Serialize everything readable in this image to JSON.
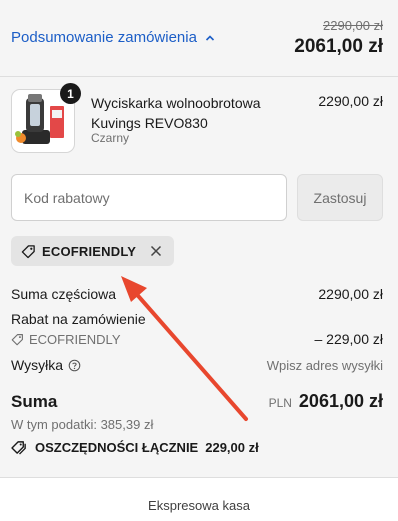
{
  "summary": {
    "toggle_label": "Podsumowanie zamówienia",
    "old_total": "2290,00 zł",
    "new_total": "2061,00 zł"
  },
  "product": {
    "quantity": "1",
    "name": "Wyciskarka wolnoobrotowa Kuvings REVO830",
    "variant": "Czarny",
    "price": "2290,00 zł"
  },
  "discount": {
    "placeholder": "Kod rabatowy",
    "apply_label": "Zastosuj",
    "applied_code": "ECOFRIENDLY"
  },
  "totals": {
    "subtotal_label": "Suma częściowa",
    "subtotal_value": "2290,00 zł",
    "order_discount_label": "Rabat na zamówienie",
    "order_discount_code": "ECOFRIENDLY",
    "order_discount_value": "– 229,00 zł",
    "shipping_label": "Wysyłka",
    "shipping_value": "Wpisz adres wysyłki",
    "total_label": "Suma",
    "currency": "PLN",
    "total_value": "2061,00 zł",
    "tax_note": "W tym podatki: 385,39 zł",
    "savings_label": "OSZCZĘDNOŚCI ŁĄCZNIE",
    "savings_value": "229,00 zł"
  },
  "footer": {
    "express_label": "Ekspresowa kasa"
  },
  "colors": {
    "link": "#1c5ec7",
    "annotation_arrow": "#e8472e"
  }
}
